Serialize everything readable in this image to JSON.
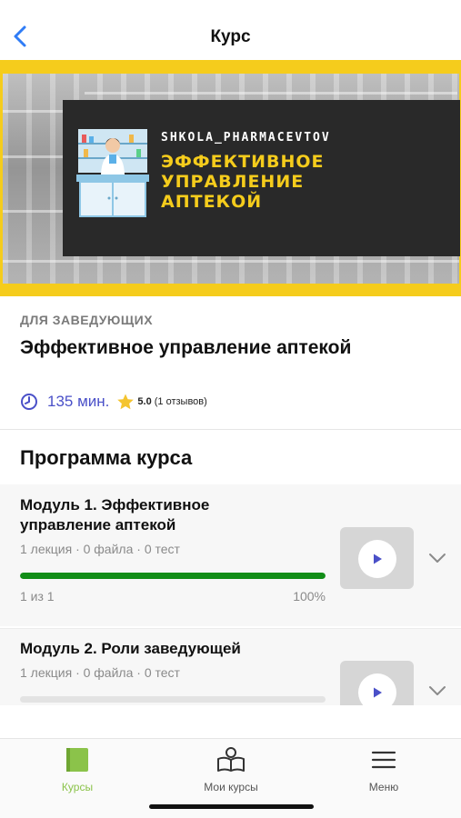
{
  "header": {
    "title": "Курс",
    "back_icon": "chevron-left-icon"
  },
  "banner": {
    "brand": "SHKOLA_PHARMACEVTOV",
    "headline": "ЭФФЕКТИВНОЕ\nУПРАВЛЕНИЕ\nАПТЕКОЙ"
  },
  "course": {
    "category": "ДЛЯ ЗАВЕДУЮЩИХ",
    "title": "Эффективное управление аптекой",
    "duration": "135 мин.",
    "rating": "5.0",
    "reviews": "(1 отзывов)"
  },
  "program": {
    "title": "Программа курса",
    "modules": [
      {
        "title": "Модуль 1. Эффективное управление аптекой",
        "stats": "1 лекция · 0 файла · 0 тест",
        "progress_fraction": 1.0,
        "progress_count": "1 из 1",
        "progress_percent": "100%"
      },
      {
        "title": "Модуль 2. Роли заведующей",
        "stats": "1 лекция · 0 файла · 0 тест"
      }
    ]
  },
  "tabs": [
    {
      "label": "Курсы",
      "icon": "book-icon",
      "active": true
    },
    {
      "label": "Мои курсы",
      "icon": "reader-icon",
      "active": false
    },
    {
      "label": "Меню",
      "icon": "menu-icon",
      "active": false
    }
  ],
  "colors": {
    "accent_blue": "#4a50c8",
    "banner_yellow": "#f5cc1c",
    "progress_green": "#118d17",
    "active_tab_green": "#8bc34a"
  }
}
